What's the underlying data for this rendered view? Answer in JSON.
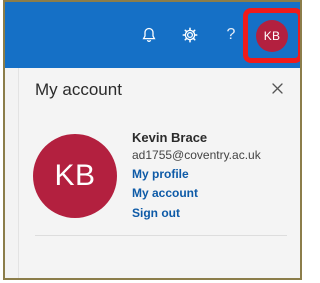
{
  "topbar": {
    "bell_icon": "bell-icon",
    "settings_icon": "gear-icon",
    "help_glyph": "?",
    "avatar_initials": "KB",
    "accent_color": "#1570c6",
    "avatar_color": "#b3203f",
    "highlight_color": "#ef1b1b"
  },
  "panel": {
    "title": "My account",
    "close_icon": "close-icon",
    "avatar_initials": "KB",
    "user_name": "Kevin Brace",
    "user_email": "ad1755@coventry.ac.uk",
    "links": {
      "profile": "My profile",
      "account": "My account",
      "signout": "Sign out"
    }
  }
}
